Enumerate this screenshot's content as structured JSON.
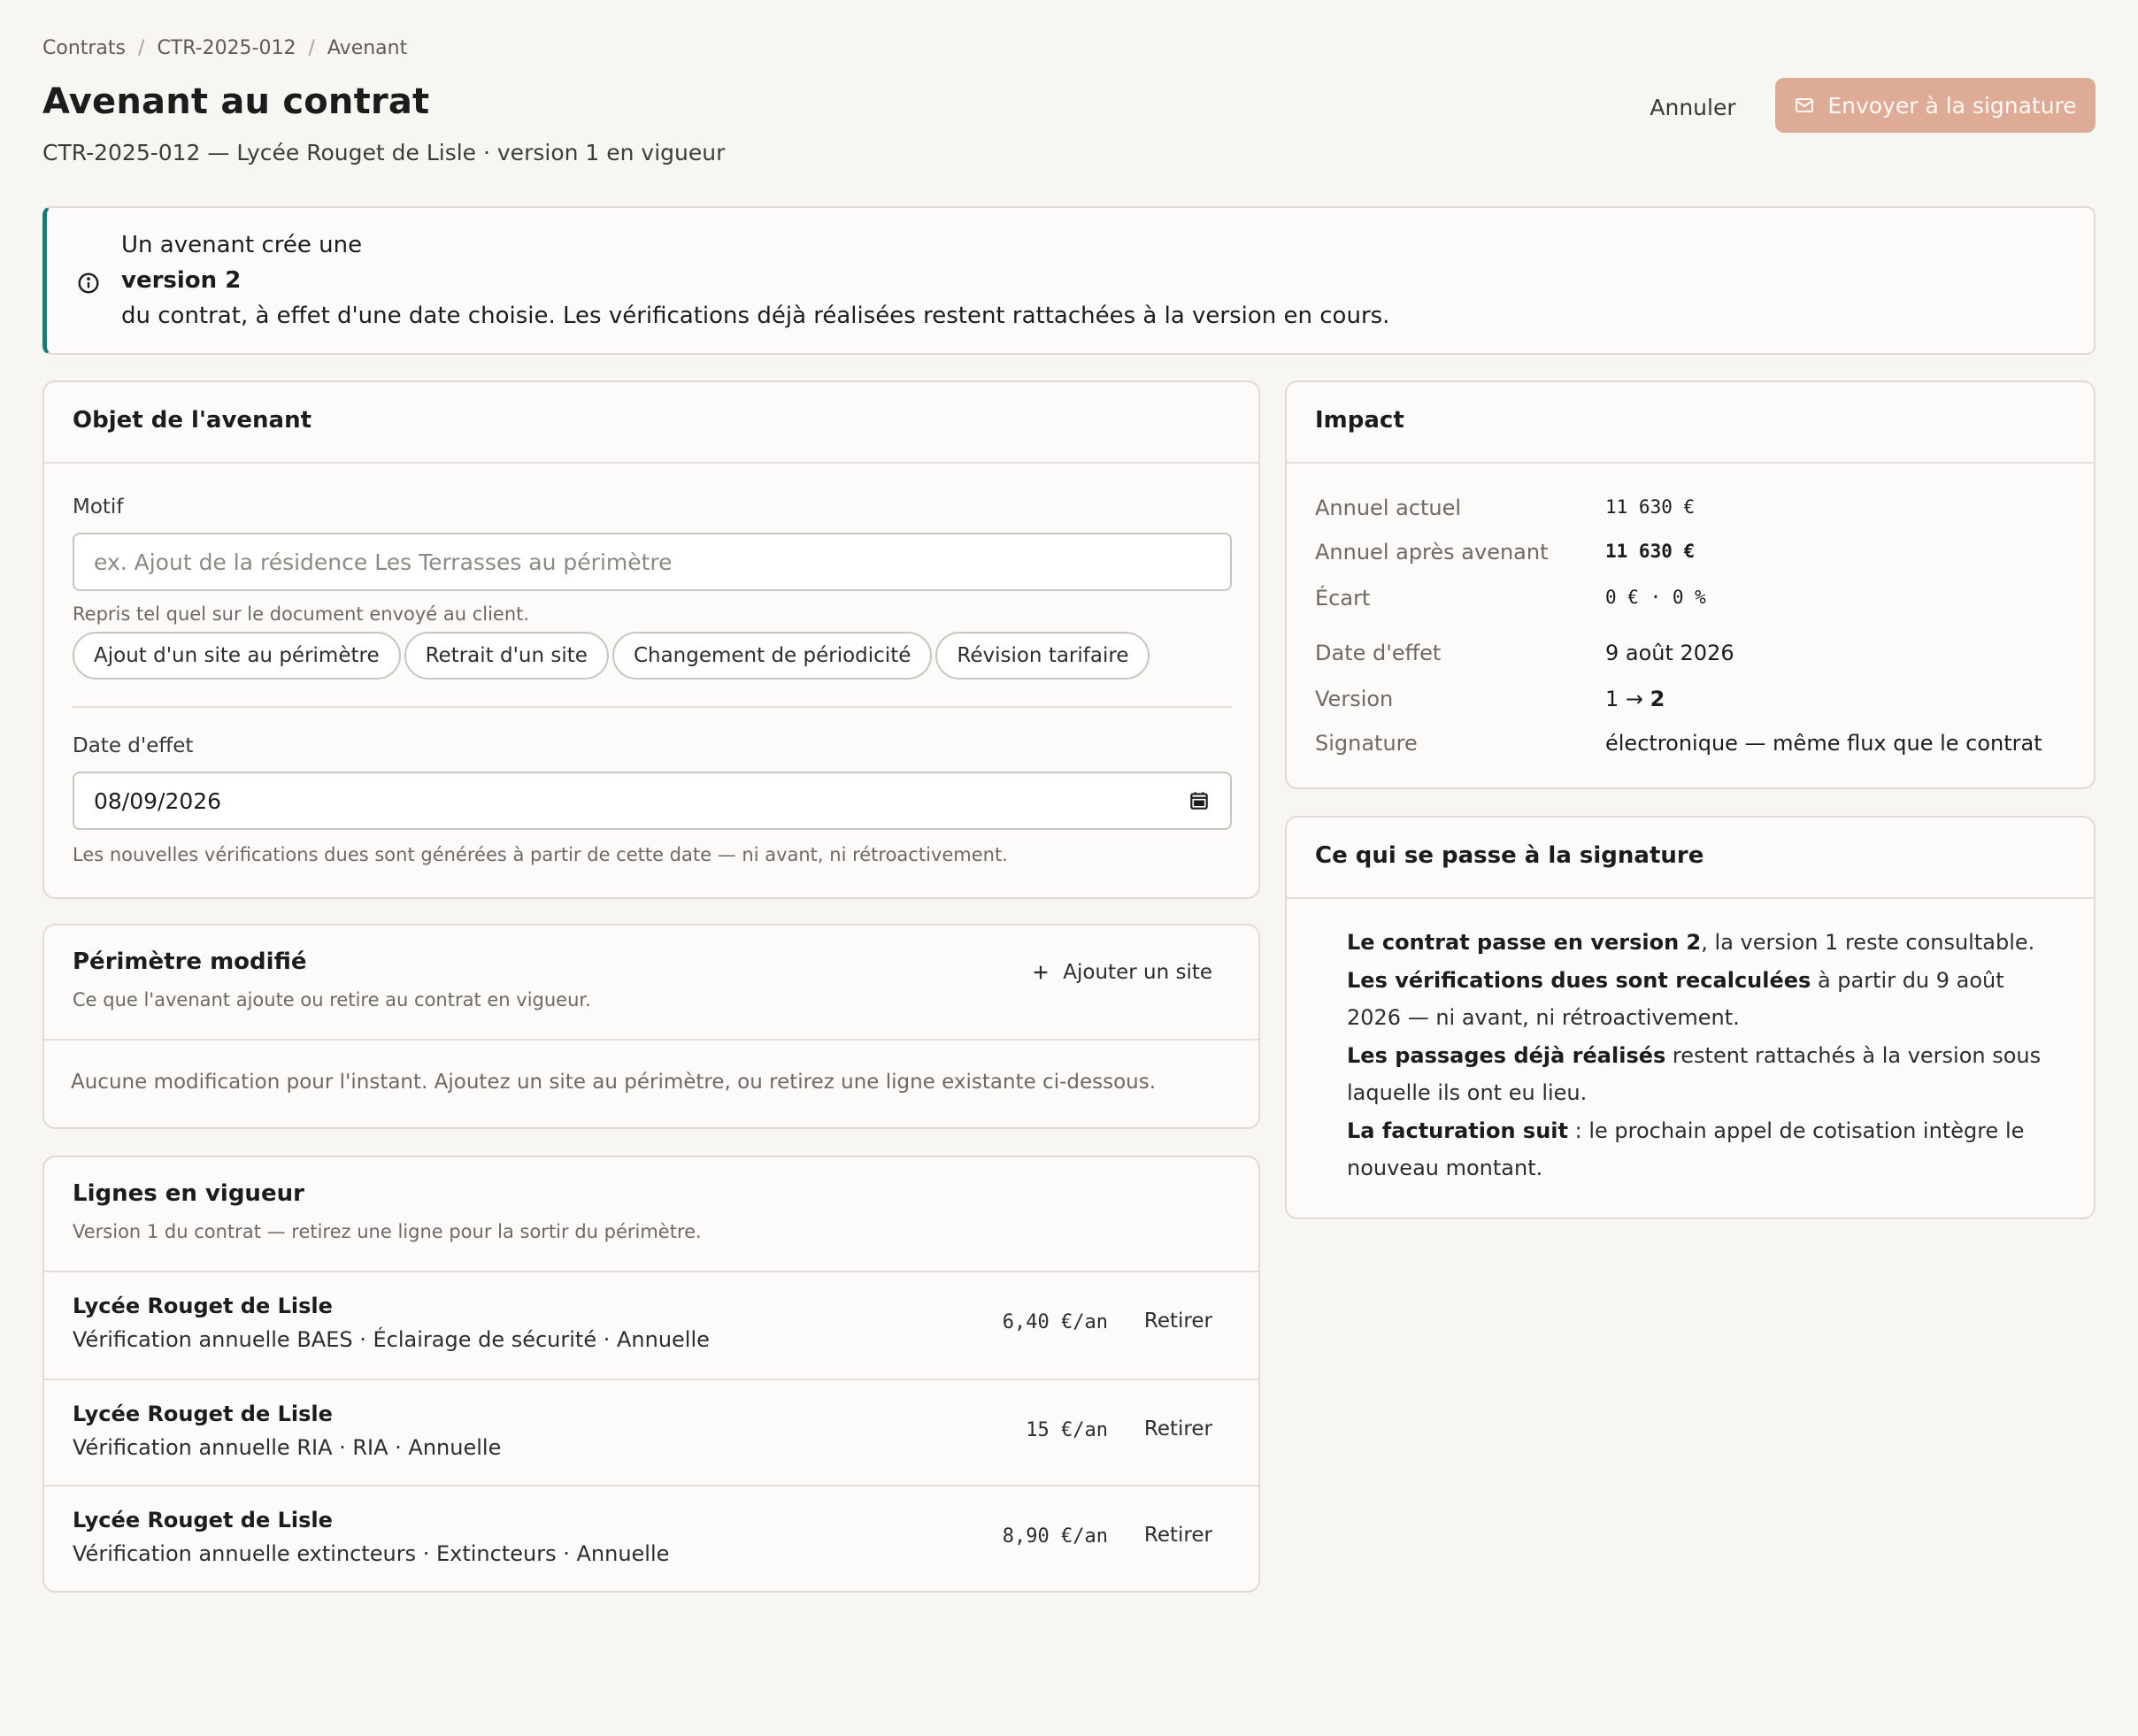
{
  "breadcrumb": [
    "Contrats",
    "CTR-2025-012",
    "Avenant"
  ],
  "breadcrumb_sep": "/",
  "page": {
    "title": "Avenant au contrat",
    "subtitle": "CTR-2025-012 — Lycée Rouget de Lisle · version 1 en vigueur"
  },
  "actions": {
    "cancel": "Annuler",
    "send": "Envoyer à la signature",
    "send_icon": "mail-icon"
  },
  "notice": {
    "icon": "info-icon",
    "line1": "Un avenant crée une",
    "bold": "version 2",
    "line2": "du contrat, à effet d'une date choisie. Les vérifications déjà réalisées restent rattachées à la version en cours."
  },
  "objet": {
    "title": "Objet de l'avenant",
    "motif_label": "Motif",
    "motif_placeholder": "ex. Ajout de la résidence Les Terrasses au périmètre",
    "motif_value": "",
    "motif_hint": "Repris tel quel sur le document envoyé au client.",
    "chips": [
      "Ajout d'un site au périmètre",
      "Retrait d'un site",
      "Changement de périodicité",
      "Révision tarifaire"
    ],
    "date_label": "Date d'effet",
    "date_value": "08/09/2026",
    "date_hint": "Les nouvelles vérifications dues sont générées à partir de cette date — ni avant, ni rétroactivement."
  },
  "perimetre": {
    "title": "Périmètre modifié",
    "subtitle": "Ce que l'avenant ajoute ou retire au contrat en vigueur.",
    "add_button": "Ajouter un site",
    "empty": "Aucune modification pour l'instant. Ajoutez un site au périmètre, ou retirez une ligne existante ci-dessous."
  },
  "lignes": {
    "title": "Lignes en vigueur",
    "subtitle": "Version 1 du contrat — retirez une ligne pour la sortir du périmètre.",
    "remove_label": "Retirer",
    "rows": [
      {
        "name": "Lycée Rouget de Lisle",
        "desc": "Vérification annuelle BAES · Éclairage de sécurité · Annuelle",
        "price": "6,40 €/an"
      },
      {
        "name": "Lycée Rouget de Lisle",
        "desc": "Vérification annuelle RIA · RIA · Annuelle",
        "price": "15 €/an"
      },
      {
        "name": "Lycée Rouget de Lisle",
        "desc": "Vérification annuelle extincteurs · Extincteurs · Annuelle",
        "price": "8,90 €/an"
      }
    ]
  },
  "impact": {
    "title": "Impact",
    "annuel_actuel_label": "Annuel actuel",
    "annuel_actuel": "11 630 €",
    "annuel_apres_label": "Annuel après avenant",
    "annuel_apres": "11 630 €",
    "ecart_label": "Écart",
    "ecart": "0 € · 0 %",
    "date_label": "Date d'effet",
    "date": "9 août 2026",
    "version_label": "Version",
    "version_from": "1",
    "version_arrow": "→",
    "version_to": "2",
    "signature_label": "Signature",
    "signature": "électronique — même flux que le contrat"
  },
  "signature_info": {
    "title": "Ce qui se passe à la signature",
    "items": [
      {
        "bold": "Le contrat passe en version 2",
        "rest": ", la version 1 reste consultable."
      },
      {
        "bold": "Les vérifications dues sont recalculées",
        "rest": " à partir du 9 août 2026 — ni avant, ni rétroactivement."
      },
      {
        "bold": "Les passages déjà réalisés",
        "rest": " restent rattachés à la version sous laquelle ils ont eu lieu."
      },
      {
        "bold": "La facturation suit",
        "rest": " : le prochain appel de cotisation intègre le nouveau montant."
      }
    ]
  },
  "colors": {
    "accent": "#1a7a78",
    "send_button": "#deac96",
    "background": "#f7f6f3"
  }
}
